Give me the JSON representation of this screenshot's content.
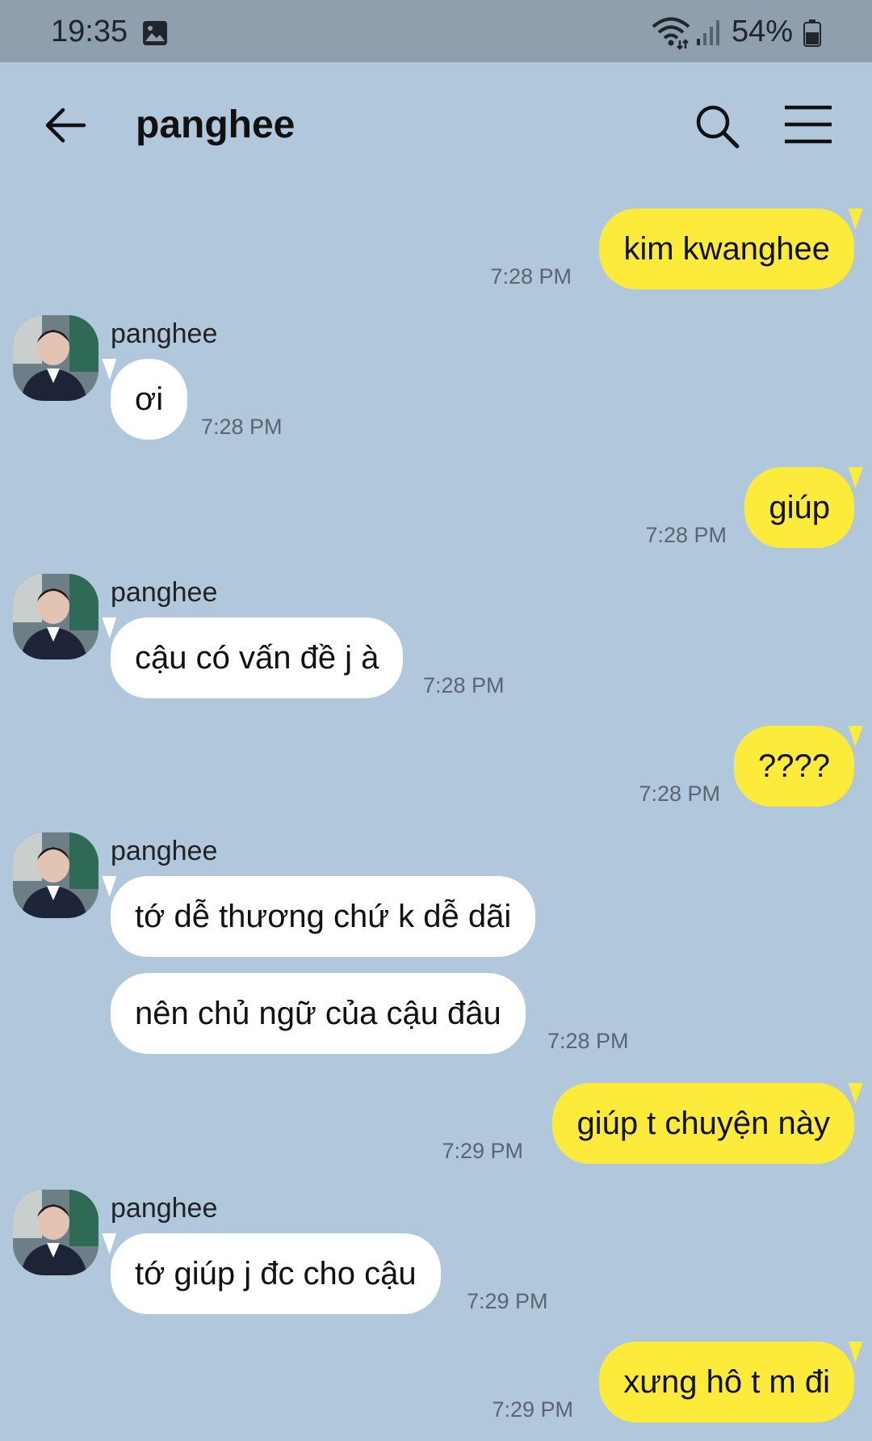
{
  "status_bar": {
    "time": "19:35",
    "battery": "54%"
  },
  "header": {
    "title": "panghee"
  },
  "messages": [
    {
      "type": "sent",
      "text": "kim kwanghee",
      "time": "7:28 PM"
    },
    {
      "type": "received",
      "sender": "panghee",
      "text": "ơi",
      "time": "7:28 PM"
    },
    {
      "type": "sent",
      "text": "giúp",
      "time": "7:28 PM"
    },
    {
      "type": "received",
      "sender": "panghee",
      "text": "cậu có vấn đề j à",
      "time": "7:28 PM"
    },
    {
      "type": "sent",
      "text": "????",
      "time": "7:28 PM"
    },
    {
      "type": "received",
      "sender": "panghee",
      "text": "tớ dễ thương chứ k dễ dãi"
    },
    {
      "type": "received",
      "text": "nên chủ ngữ của cậu đâu",
      "time": "7:28 PM"
    },
    {
      "type": "sent",
      "text": "giúp t chuyện này",
      "time": "7:29 PM"
    },
    {
      "type": "received",
      "sender": "panghee",
      "text": "tớ giúp j đc cho cậu",
      "time": "7:29 PM"
    },
    {
      "type": "sent",
      "text": "xưng hô t m đi",
      "time": "7:29 PM"
    }
  ],
  "colors": {
    "background": "#b1c7db",
    "sent_bubble": "#fceb3b",
    "received_bubble": "#ffffff",
    "status_bar": "#8f9fae"
  },
  "icons": [
    "photo-icon",
    "wifi-icon",
    "signal-icon",
    "battery-icon",
    "back-arrow-icon",
    "search-icon",
    "menu-icon"
  ]
}
